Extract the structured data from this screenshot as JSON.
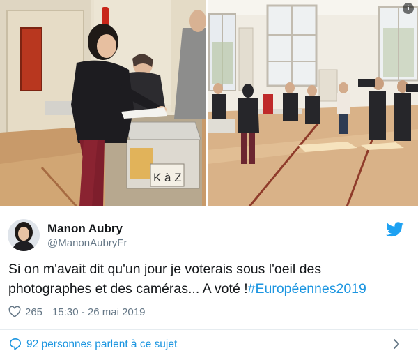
{
  "tweet": {
    "author_name": "Manon Aubry",
    "author_handle": "@ManonAubryFr",
    "text_before": "Si on m'avait dit qu'un jour je voterais sous l'oeil des photographes et des caméras... A voté !",
    "hashtag": "#Européennes2019",
    "likes": "265",
    "timestamp": "15:30 - 26 mai 2019",
    "conversation_link": "92 personnes parlent à ce sujet"
  },
  "media": {
    "photo_left_box_label": "K à Z"
  },
  "icons": {
    "info": "info-icon",
    "bird": "twitter-bird-icon",
    "heart": "heart-icon",
    "bubble": "reply-bubble-icon",
    "chevron": "chevron-right-icon"
  },
  "colors": {
    "link": "#1b95e0",
    "muted": "#657786",
    "text": "#14171a",
    "twitter_blue": "#1da1f2"
  }
}
